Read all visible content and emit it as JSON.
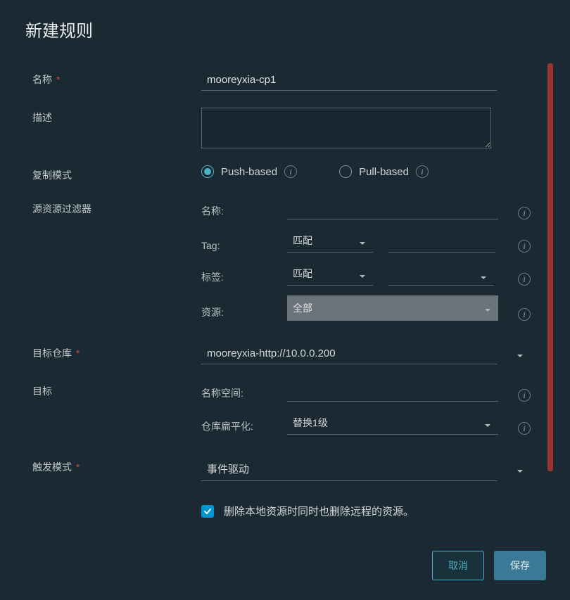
{
  "modal": {
    "title": "新建规则"
  },
  "labels": {
    "name": "名称",
    "description": "描述",
    "replication_mode": "复制模式",
    "source_filter": "源资源过滤器",
    "target_registry": "目标仓库",
    "target": "目标",
    "trigger_mode": "触发模式"
  },
  "fields": {
    "name_value": "mooreyxia-cp1",
    "description_value": ""
  },
  "radio": {
    "push_label": "Push-based",
    "pull_label": "Pull-based",
    "selected": "push"
  },
  "filters": {
    "name_label": "名称:",
    "tag_label": "Tag:",
    "label_label": "标签:",
    "resource_label": "资源:",
    "match_option": "匹配",
    "all_option": "全部"
  },
  "target_registry": {
    "value": "mooreyxia-http://10.0.0.200"
  },
  "target": {
    "namespace_label": "名称空间:",
    "flatten_label": "仓库扁平化:",
    "flatten_value": "替换1级"
  },
  "trigger": {
    "value": "事件驱动"
  },
  "checkbox": {
    "delete_remote_label": "删除本地资源时同时也删除远程的资源。",
    "checked": true
  },
  "buttons": {
    "cancel": "取消",
    "save": "保存"
  }
}
